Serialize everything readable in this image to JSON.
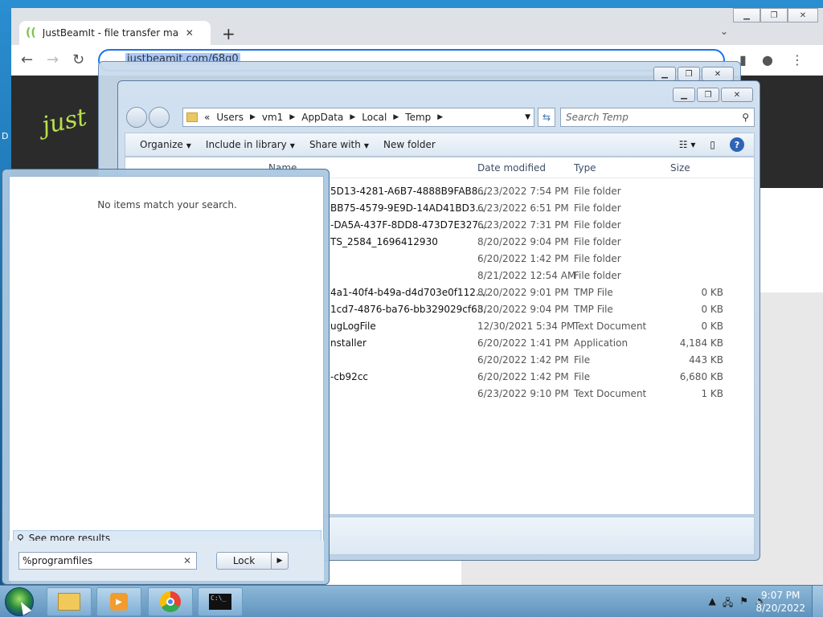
{
  "desktop": {
    "edge_letter": "D"
  },
  "browser": {
    "tab_title": "JustBeamIt - file transfer made ea",
    "url": "justbeamit.com/68g0",
    "logo_text": "just"
  },
  "explorer": {
    "breadcrumbs": [
      "Users",
      "vm1",
      "AppData",
      "Local",
      "Temp"
    ],
    "prefix": "«",
    "search_placeholder": "Search Temp",
    "commands": [
      "Organize",
      "Include in library",
      "Share with",
      "New folder"
    ],
    "columns": {
      "name": "Name",
      "date": "Date modified",
      "type": "Type",
      "size": "Size"
    },
    "rows": [
      {
        "name": "5D13-4281-A6B7-4888B9FAB8...",
        "date": "6/23/2022 7:54 PM",
        "type": "File folder",
        "size": ""
      },
      {
        "name": "BB75-4579-9E9D-14AD41BD3...",
        "date": "6/23/2022 6:51 PM",
        "type": "File folder",
        "size": ""
      },
      {
        "name": "-DA5A-437F-8DD8-473D7E327...",
        "date": "6/23/2022 7:31 PM",
        "type": "File folder",
        "size": ""
      },
      {
        "name": "TS_2584_1696412930",
        "date": "8/20/2022 9:04 PM",
        "type": "File folder",
        "size": ""
      },
      {
        "name": "",
        "date": "6/20/2022 1:42 PM",
        "type": "File folder",
        "size": ""
      },
      {
        "name": "",
        "date": "8/21/2022 12:54 AM",
        "type": "File folder",
        "size": ""
      },
      {
        "name": "4a1-40f4-b49a-d4d703e0f112....",
        "date": "8/20/2022 9:01 PM",
        "type": "TMP File",
        "size": "0 KB"
      },
      {
        "name": "1cd7-4876-ba76-bb329029cf63...",
        "date": "8/20/2022 9:04 PM",
        "type": "TMP File",
        "size": "0 KB"
      },
      {
        "name": "ugLogFile",
        "date": "12/30/2021 5:34 PM",
        "type": "Text Document",
        "size": "0 KB"
      },
      {
        "name": "nstaller",
        "date": "6/20/2022 1:41 PM",
        "type": "Application",
        "size": "4,184 KB"
      },
      {
        "name": "",
        "date": "6/20/2022 1:42 PM",
        "type": "File",
        "size": "443 KB"
      },
      {
        "name": "-cb92cc",
        "date": "6/20/2022 1:42 PM",
        "type": "File",
        "size": "6,680 KB"
      },
      {
        "name": "",
        "date": "6/23/2022 9:10 PM",
        "type": "Text Document",
        "size": "1 KB"
      }
    ]
  },
  "start_menu": {
    "no_items": "No items match your search.",
    "see_more": "See more results",
    "search_value": "%programfiles",
    "lock_label": "Lock"
  },
  "taskbar": {
    "time": "9:07 PM",
    "date": "8/20/2022",
    "cmd_icon_text": "C:\\_"
  }
}
